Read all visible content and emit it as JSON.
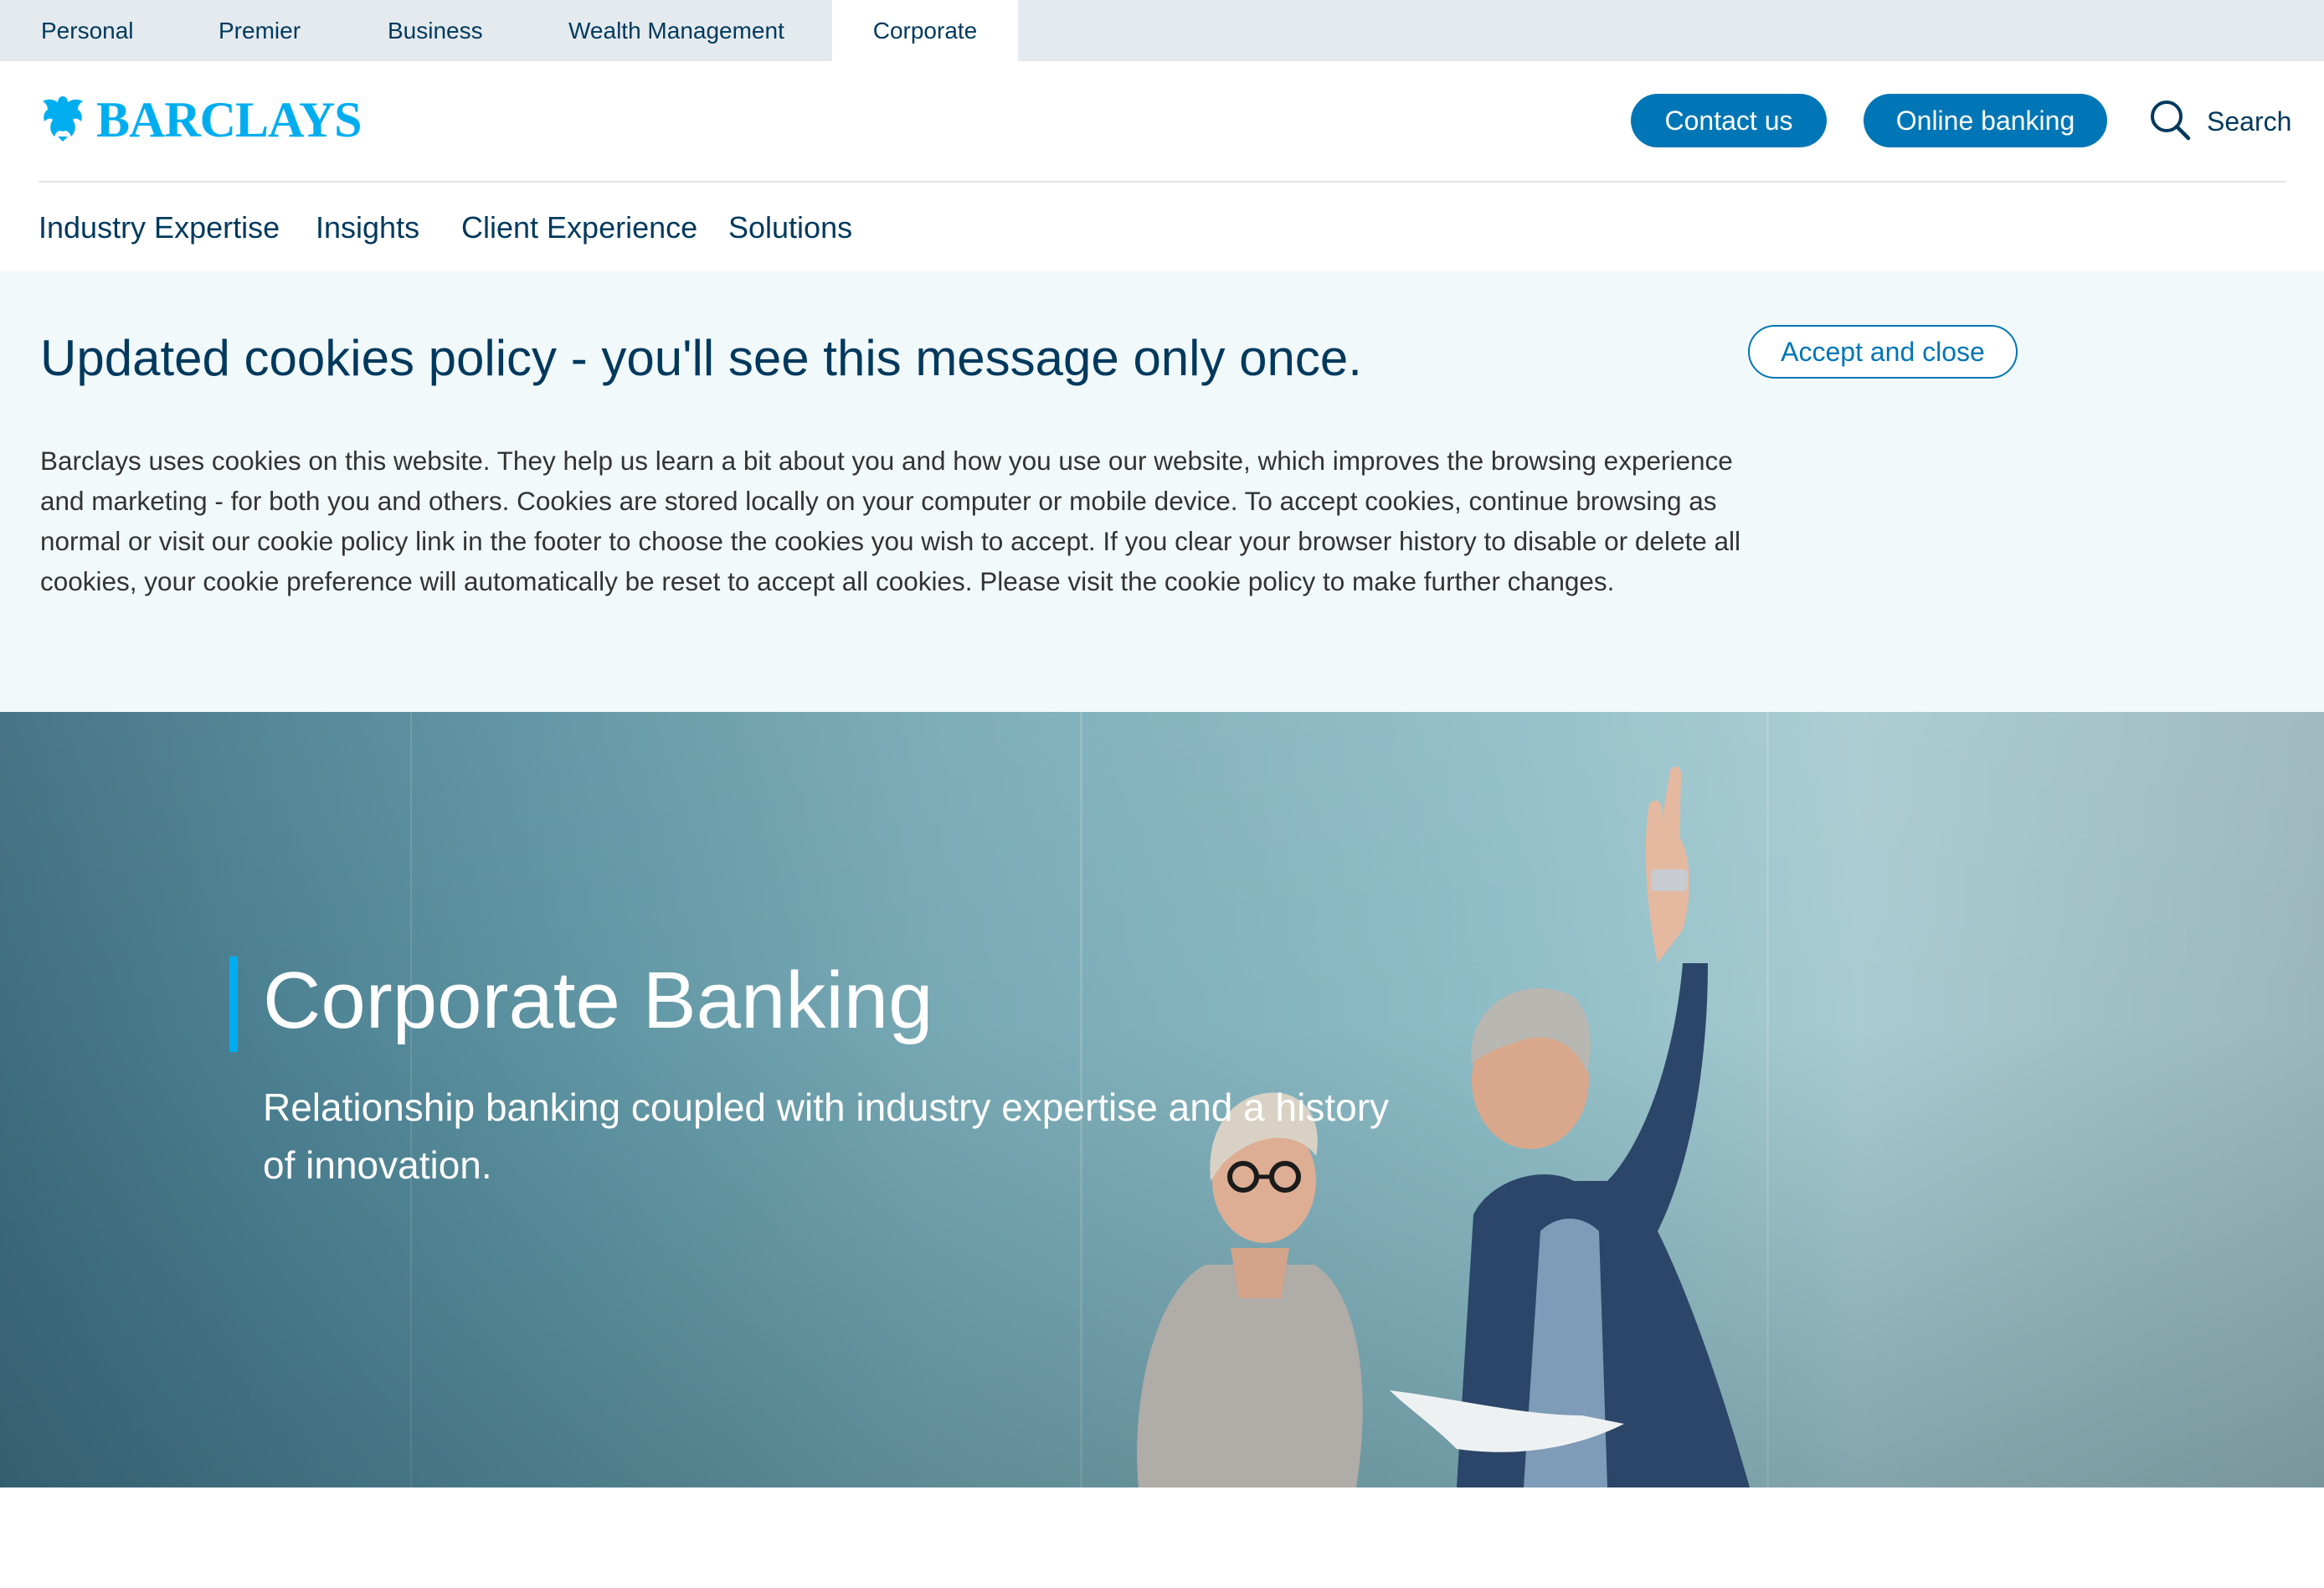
{
  "segments": {
    "personal": "Personal",
    "premier": "Premier",
    "business": "Business",
    "wealth": "Wealth Management",
    "corporate": "Corporate"
  },
  "header": {
    "logo_text": "BARCLAYS",
    "contact_label": "Contact us",
    "online_label": "Online banking",
    "search_label": "Search"
  },
  "nav": {
    "industry": "Industry Expertise",
    "insights": "Insights",
    "client": "Client Experience",
    "solutions": "Solutions"
  },
  "cookie": {
    "title": "Updated cookies policy - you'll see this message only once.",
    "body": "Barclays uses cookies on this website. They help us learn a bit about you and how you use our website, which improves the browsing experience and marketing - for both you and others. Cookies are stored locally on your computer or mobile device. To accept cookies, continue browsing as normal or visit our cookie policy link in the footer to choose the cookies you wish to accept. If you clear your browser history to disable or delete all cookies, your cookie preference will automatically be reset to accept all cookies. Please visit the cookie policy to make further changes.",
    "accept_label": "Accept and close"
  },
  "hero": {
    "title": "Corporate Banking",
    "subtitle": "Relationship banking coupled with industry expertise and a history of innovation."
  },
  "colors": {
    "brand_cyan": "#00aeef",
    "brand_blue": "#0076b6",
    "navy_text": "#00395d",
    "cookie_bg": "#f2f9fb"
  },
  "icons": {
    "logo": "eagle-icon",
    "search": "search-icon"
  }
}
